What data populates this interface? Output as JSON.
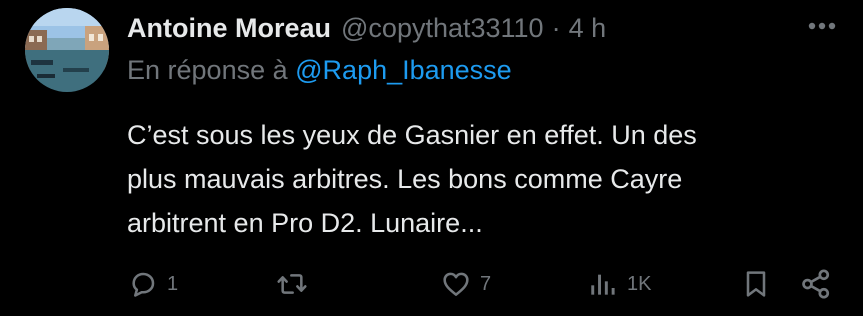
{
  "tweet": {
    "author_name": "Antoine Moreau",
    "handle": "@copythat33110",
    "separator": "·",
    "time": "4 h",
    "reply_prefix": "En réponse à",
    "reply_mention": "@Raph_Ibanesse",
    "text_lines": [
      "C’est sous les yeux de Gasnier en effet. Un des",
      "plus mauvais arbitres. Les bons comme Cayre",
      "arbitrent en Pro D2. Lunaire..."
    ]
  },
  "actions": {
    "replies": "1",
    "retweets": "",
    "likes": "7",
    "views": "1K"
  },
  "icons": {
    "avatar": "avatar-photo",
    "more": "more-dots-icon",
    "reply": "reply-bubble-icon",
    "retweet": "retweet-icon",
    "like": "heart-icon",
    "views": "views-bars-icon",
    "bookmark": "bookmark-icon",
    "share": "share-icon"
  },
  "colors": {
    "background": "#000000",
    "text": "#e7e9ea",
    "muted": "#71767b",
    "link": "#1d9bf0"
  }
}
